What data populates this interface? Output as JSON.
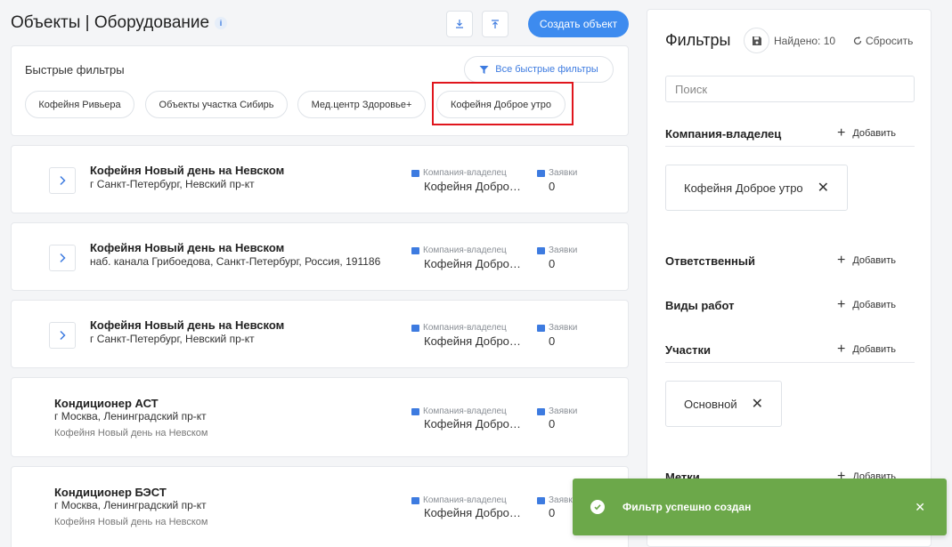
{
  "header": {
    "title": "Объекты | Оборудование",
    "info_icon": "i",
    "create_label": "Создать объект"
  },
  "quick_filters": {
    "title": "Быстрые фильтры",
    "all_label": "Все быстрые фильтры",
    "chips": [
      "Кофейня Ривьера",
      "Объекты участка Сибирь",
      "Мед.центр Здоровье+",
      "Кофейня Доброе утро"
    ]
  },
  "objects": [
    {
      "name": "Кофейня Новый день на Невском",
      "address": "г Санкт-Петербург, Невский пр-кт",
      "owner_label": "Компания-владелец",
      "owner": "Кофейня Добро…",
      "requests_label": "Заявки",
      "requests": "0"
    },
    {
      "name": "Кофейня Новый день на Невском",
      "address": "наб. канала Грибоедова, Санкт-Петербург, Россия, 191186",
      "owner_label": "Компания-владелец",
      "owner": "Кофейня Добро…",
      "requests_label": "Заявки",
      "requests": "0"
    },
    {
      "name": "Кофейня Новый день на Невском",
      "address": "г Санкт-Петербург, Невский пр-кт",
      "owner_label": "Компания-владелец",
      "owner": "Кофейня Добро…",
      "requests_label": "Заявки",
      "requests": "0"
    },
    {
      "name": "Кондиционер АСТ",
      "address": "г Москва, Ленинградский пр-кт",
      "parent": "Кофейня Новый день на Невском",
      "owner_label": "Компания-владелец",
      "owner": "Кофейня Добро…",
      "requests_label": "Заявки",
      "requests": "0"
    },
    {
      "name": "Кондиционер БЭСТ",
      "address": "г Москва, Ленинградский пр-кт",
      "parent": "Кофейня Новый день на Невском",
      "owner_label": "Компания-владелец",
      "owner": "Кофейня Добро…",
      "requests_label": "Заявки",
      "requests": "0"
    }
  ],
  "filters": {
    "title": "Фильтры",
    "found": "Найдено: 10",
    "reset_label": "Сбросить",
    "search_placeholder": "Поиск",
    "add_label": "Добавить",
    "sections": {
      "owner": "Компания-владелец",
      "responsible": "Ответственный",
      "work_types": "Виды работ",
      "sites": "Участки",
      "tags": "Метки"
    },
    "owner_tag": "Кофейня Доброе утро",
    "sites_tag": "Основной"
  },
  "toast": {
    "text": "Фильтр успешно создан"
  },
  "colors": {
    "accent": "#3d8bef",
    "highlight": "#e0161d",
    "toast": "#6ca84a"
  }
}
